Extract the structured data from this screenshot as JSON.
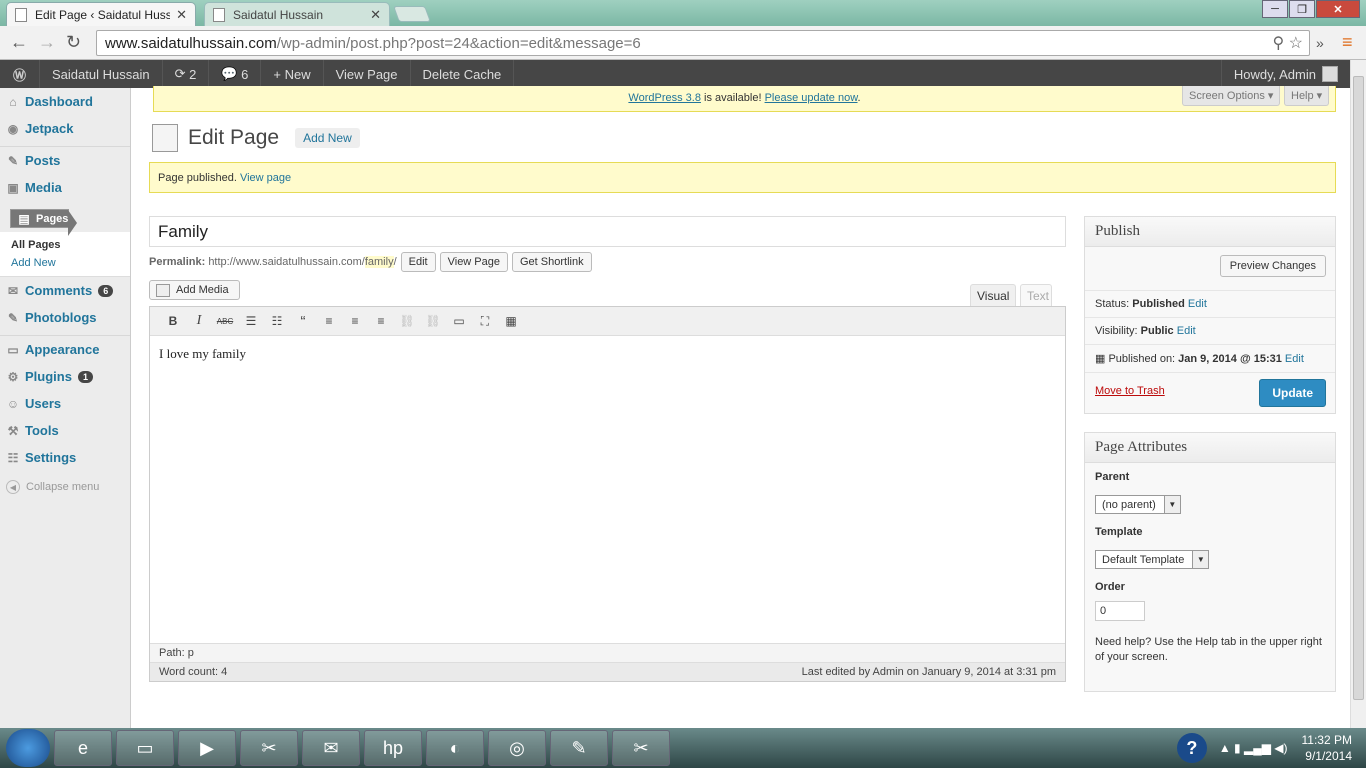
{
  "browser": {
    "tabs": [
      {
        "title": "Edit Page ‹ Saidatul Hussa",
        "close": "✕"
      },
      {
        "title": "Saidatul Hussain",
        "close": "✕"
      }
    ],
    "url_host": "www.saidatulhussain.com",
    "url_path": "/wp-admin/post.php?post=24&action=edit&message=6"
  },
  "adminbar": {
    "site_name": "Saidatul Hussain",
    "updates": "2",
    "comments": "6",
    "new": "New",
    "view_page": "View Page",
    "delete_cache": "Delete Cache",
    "howdy": "Howdy, Admin"
  },
  "sidebar": {
    "items": [
      {
        "label": "Dashboard",
        "icon": "dashboard-icon"
      },
      {
        "label": "Jetpack",
        "icon": "jetpack-icon"
      },
      {
        "label": "Posts",
        "icon": "pin-icon"
      },
      {
        "label": "Media",
        "icon": "media-icon"
      },
      {
        "label": "Pages",
        "icon": "pages-icon"
      },
      {
        "label": "Comments",
        "icon": "comment-icon",
        "badge": "6"
      },
      {
        "label": "Photoblogs",
        "icon": "pin-icon"
      },
      {
        "label": "Appearance",
        "icon": "appearance-icon"
      },
      {
        "label": "Plugins",
        "icon": "plugin-icon",
        "badge": "1"
      },
      {
        "label": "Users",
        "icon": "users-icon"
      },
      {
        "label": "Tools",
        "icon": "tools-icon"
      },
      {
        "label": "Settings",
        "icon": "settings-icon"
      }
    ],
    "submenu": [
      "All Pages",
      "Add New"
    ],
    "collapse": "Collapse menu"
  },
  "notice": {
    "update_link": "WordPress 3.8",
    "middle": " is available! ",
    "please_update": "Please update now",
    "end": "."
  },
  "screen_options": "Screen Options ▾",
  "help": "Help ▾",
  "page": {
    "heading": "Edit Page",
    "add_new": "Add New",
    "published_msg": "Page published. ",
    "view_page_link": "View page",
    "title_value": "Family",
    "permalink_label": "Permalink:",
    "permalink_base": "http://www.saidatulhussain.com/",
    "permalink_slug": "family",
    "permalink_end": "/",
    "permalink_buttons": [
      "Edit",
      "View Page",
      "Get Shortlink"
    ],
    "add_media": "Add Media",
    "tab_visual": "Visual",
    "tab_text": "Text",
    "content": "I love my family",
    "path": "Path: p",
    "word_count": "Word count: 4",
    "last_edited": "Last edited by Admin on January 9, 2014 at 3:31 pm"
  },
  "publish": {
    "title": "Publish",
    "preview": "Preview Changes",
    "status_label": "Status: ",
    "status_value": "Published",
    "visibility_label": "Visibility: ",
    "visibility_value": "Public",
    "published_on_label": "Published on: ",
    "published_on_value": "Jan 9, 2014 @ 15:31",
    "edit": "Edit",
    "trash": "Move to Trash",
    "update": "Update"
  },
  "attributes": {
    "title": "Page Attributes",
    "parent_label": "Parent",
    "parent_value": "(no parent)",
    "template_label": "Template",
    "template_value": "Default Template",
    "order_label": "Order",
    "order_value": "0",
    "help_text": "Need help? Use the Help tab in the upper right of your screen."
  },
  "taskbar": {
    "time": "11:32 PM",
    "date": "9/1/2014",
    "help": "?"
  },
  "colors": {
    "accent": "#21759b",
    "adminbar": "#464646",
    "notice_bg": "#fffbcc",
    "update_button": "#2e8cc2",
    "trash": "#bc0b0b"
  }
}
